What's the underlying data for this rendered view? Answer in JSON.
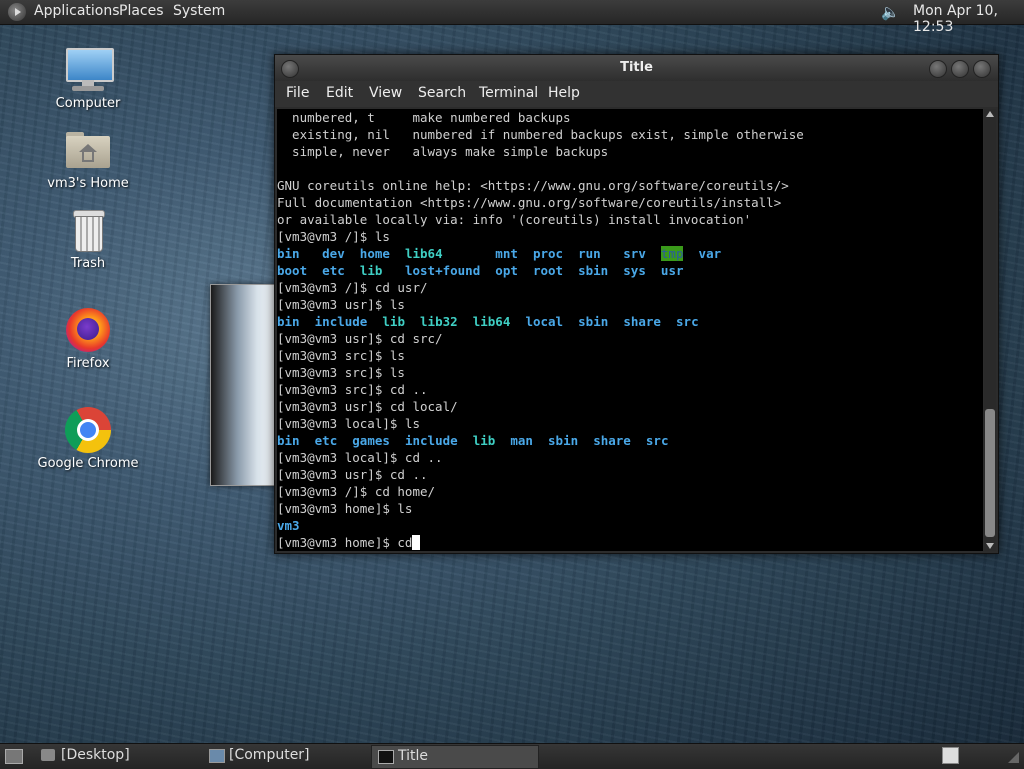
{
  "top_panel": {
    "menus": [
      "Applications",
      "Places",
      "System"
    ],
    "clock": "Mon Apr 10, 12:53"
  },
  "desktop_icons": [
    {
      "label": "Computer",
      "icon": "computer-icon"
    },
    {
      "label": "vm3's Home",
      "icon": "home-folder-icon"
    },
    {
      "label": "Trash",
      "icon": "trash-icon"
    },
    {
      "label": "Firefox",
      "icon": "firefox-icon"
    },
    {
      "label": "Google Chrome",
      "icon": "chrome-icon"
    }
  ],
  "window": {
    "title": "Title",
    "menu": [
      "File",
      "Edit",
      "View",
      "Search",
      "Terminal",
      "Help"
    ]
  },
  "terminal": {
    "lines": [
      "  numbered, t     make numbered backups",
      "  existing, nil   numbered if numbered backups exist, simple otherwise",
      "  simple, never   always make simple backups",
      "",
      "GNU coreutils online help: <https://www.gnu.org/software/coreutils/>",
      "Full documentation <https://www.gnu.org/software/coreutils/install>",
      "or available locally via: info '(coreutils) install invocation'",
      "[vm3@vm3 /]$ ls",
      "bin   dev  home  lib64       mnt  proc  run   srv  tmp  var",
      "boot  etc  lib   lost+found  opt  root  sbin  sys  usr",
      "[vm3@vm3 /]$ cd usr/",
      "[vm3@vm3 usr]$ ls",
      "bin  include  lib  lib32  lib64  local  sbin  share  src",
      "[vm3@vm3 usr]$ cd src/",
      "[vm3@vm3 src]$ ls",
      "[vm3@vm3 src]$ ls",
      "[vm3@vm3 src]$ cd ..",
      "[vm3@vm3 usr]$ cd local/",
      "[vm3@vm3 local]$ ls",
      "bin  etc  games  include  lib  man  sbin  share  src",
      "[vm3@vm3 local]$ cd ..",
      "[vm3@vm3 usr]$ cd ..",
      "[vm3@vm3 /]$ cd home/",
      "[vm3@vm3 home]$ ls",
      "vm3",
      "[vm3@vm3 home]$ cd"
    ]
  },
  "taskbar": {
    "items": [
      "[Desktop]",
      "[Computer]",
      "Title"
    ]
  },
  "colors": {
    "dir": "#4aa8e8",
    "link": "#3fcfc4",
    "sticky_bg": "#3a9a1a"
  }
}
